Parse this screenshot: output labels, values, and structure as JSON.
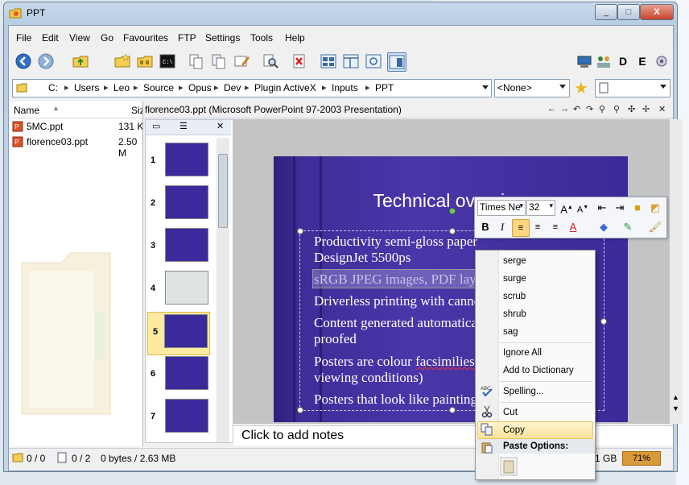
{
  "window": {
    "title": "PPT",
    "controls": {
      "minimize": "_",
      "maximize": "□",
      "close": "X"
    }
  },
  "menu": [
    "File",
    "Edit",
    "View",
    "Go",
    "Favourites",
    "FTP",
    "Settings",
    "Tools",
    "Help"
  ],
  "breadcrumb": [
    "C:",
    "Users",
    "Leo",
    "Source",
    "Opus",
    "Dev",
    "Plugin ActiveX",
    "Inputs",
    "PPT"
  ],
  "address": {
    "filter_value": "<None>"
  },
  "file_list": {
    "columns": {
      "name": "Name",
      "size": "Siz"
    },
    "files": [
      {
        "name": "5MC.ppt",
        "size": "131 K"
      },
      {
        "name": "florence03.ppt",
        "size": "2.50 M"
      }
    ]
  },
  "viewer": {
    "title": "florence03.ppt (Microsoft PowerPoint 97-2003 Presentation)",
    "thumbnails": [
      "1",
      "2",
      "3",
      "4",
      "5",
      "6",
      "7"
    ],
    "selected_thumbnail": "5",
    "notes_placeholder": "Click to add notes"
  },
  "slide": {
    "title": "Technical overview",
    "bullets": [
      {
        "line1": "Productivity semi-gloss paper",
        "line2": "DesignJet 5500ps"
      },
      {
        "line1": "sRGB JPEG images, PDF layout",
        "line2": ""
      },
      {
        "line1": "Driverless printing with canno",
        "line2": ""
      },
      {
        "line1": "Content generated automatica",
        "line2": "proofed"
      },
      {
        "line1": "Posters are colour facsimilies",
        "line2": "viewing  conditions)"
      },
      {
        "line1": "Posters that look like painting",
        "line2": ""
      }
    ]
  },
  "mini_toolbar": {
    "font_name": "Times Ne",
    "font_size": "32",
    "bold": "B",
    "italic": "I"
  },
  "context_menu": {
    "suggestions": [
      "serge",
      "surge",
      "scrub",
      "shrub",
      "sag"
    ],
    "ignore_all": "Ignore All",
    "add_to_dictionary": "Add to Dictionary",
    "spelling": "Spelling...",
    "cut": "Cut",
    "copy": "Copy",
    "paste_options": "Paste Options:"
  },
  "status": {
    "folders": "0 / 0",
    "files": "0 / 2",
    "size": "0 bytes / 2.63 MB",
    "free": "1 GB",
    "percent": "71%"
  },
  "colors": {
    "slide_bg": "#3f2d99",
    "highlight": "#fbe29a",
    "space_bar": "#d89a38"
  }
}
